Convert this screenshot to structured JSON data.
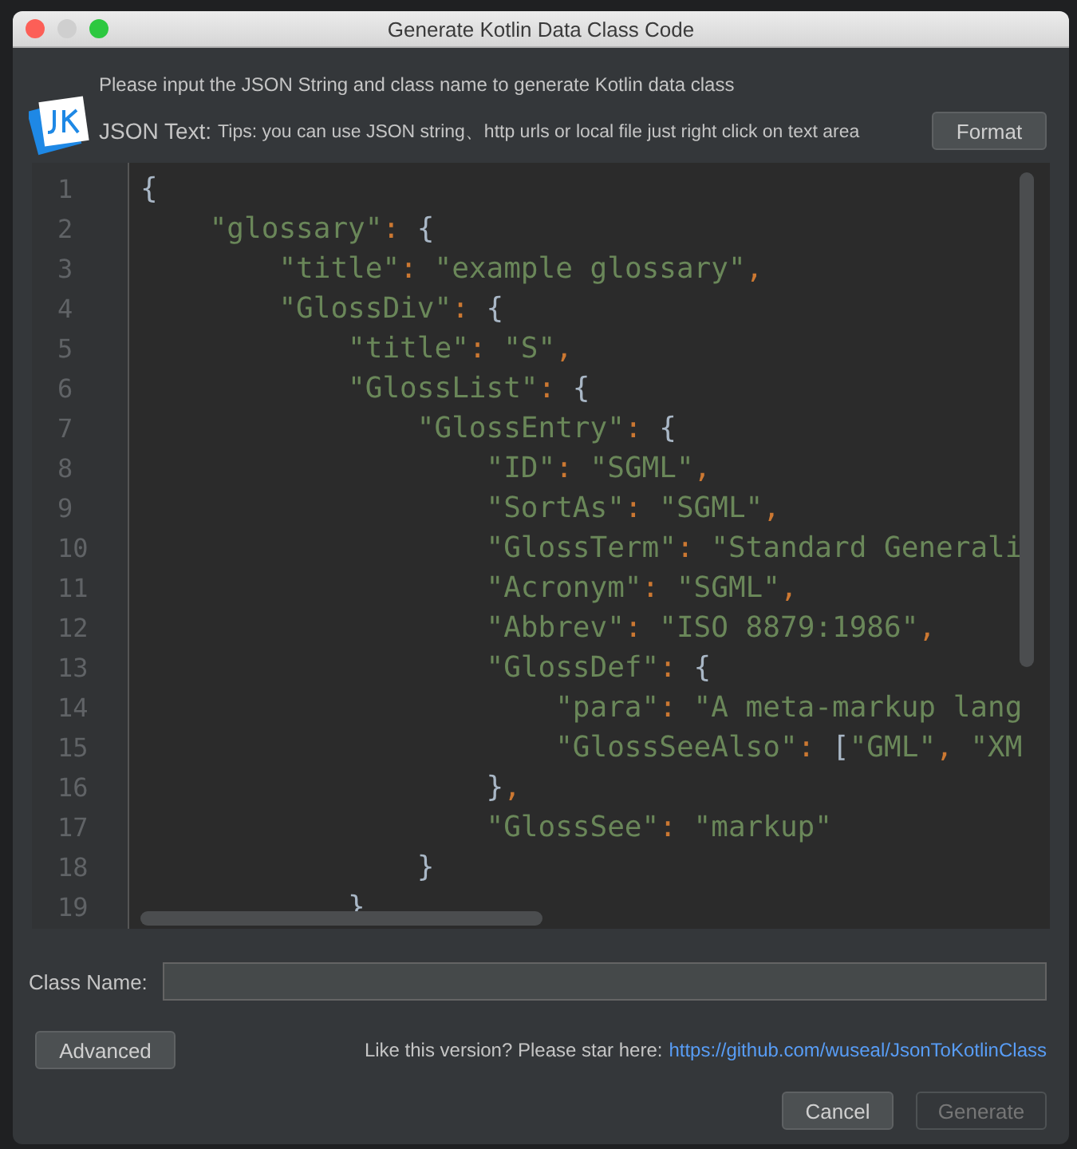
{
  "window": {
    "title": "Generate Kotlin Data Class Code"
  },
  "header": {
    "description": "Please input the JSON String and class name to generate Kotlin data class"
  },
  "json_text": {
    "label": "JSON Text:",
    "tips": "Tips: you can use JSON string、http urls or local file just right click on text area",
    "format_button": "Format"
  },
  "editor": {
    "lines": [
      {
        "number": "1",
        "tokens": [
          {
            "kind": "brace",
            "text": "{"
          }
        ]
      },
      {
        "number": "2",
        "tokens": [
          {
            "kind": "str",
            "text": "    \"glossary\""
          },
          {
            "kind": "punct",
            "text": ":"
          },
          {
            "kind": "brace",
            "text": " {"
          }
        ]
      },
      {
        "number": "3",
        "tokens": [
          {
            "kind": "str",
            "text": "        \"title\""
          },
          {
            "kind": "punct",
            "text": ":"
          },
          {
            "kind": "str",
            "text": " \"example glossary\""
          },
          {
            "kind": "punct",
            "text": ","
          }
        ]
      },
      {
        "number": "4",
        "tokens": [
          {
            "kind": "str",
            "text": "        \"GlossDiv\""
          },
          {
            "kind": "punct",
            "text": ":"
          },
          {
            "kind": "brace",
            "text": " {"
          }
        ]
      },
      {
        "number": "5",
        "tokens": [
          {
            "kind": "str",
            "text": "            \"title\""
          },
          {
            "kind": "punct",
            "text": ":"
          },
          {
            "kind": "str",
            "text": " \"S\""
          },
          {
            "kind": "punct",
            "text": ","
          }
        ]
      },
      {
        "number": "6",
        "tokens": [
          {
            "kind": "str",
            "text": "            \"GlossList\""
          },
          {
            "kind": "punct",
            "text": ":"
          },
          {
            "kind": "brace",
            "text": " {"
          }
        ]
      },
      {
        "number": "7",
        "tokens": [
          {
            "kind": "str",
            "text": "                \"GlossEntry\""
          },
          {
            "kind": "punct",
            "text": ":"
          },
          {
            "kind": "brace",
            "text": " {"
          }
        ]
      },
      {
        "number": "8",
        "tokens": [
          {
            "kind": "str",
            "text": "                    \"ID\""
          },
          {
            "kind": "punct",
            "text": ":"
          },
          {
            "kind": "str",
            "text": " \"SGML\""
          },
          {
            "kind": "punct",
            "text": ","
          }
        ]
      },
      {
        "number": "9",
        "tokens": [
          {
            "kind": "str",
            "text": "                    \"SortAs\""
          },
          {
            "kind": "punct",
            "text": ":"
          },
          {
            "kind": "str",
            "text": " \"SGML\""
          },
          {
            "kind": "punct",
            "text": ","
          }
        ]
      },
      {
        "number": "10",
        "tokens": [
          {
            "kind": "str",
            "text": "                    \"GlossTerm\""
          },
          {
            "kind": "punct",
            "text": ":"
          },
          {
            "kind": "str",
            "text": " \"Standard Generali"
          }
        ]
      },
      {
        "number": "11",
        "tokens": [
          {
            "kind": "str",
            "text": "                    \"Acronym\""
          },
          {
            "kind": "punct",
            "text": ":"
          },
          {
            "kind": "str",
            "text": " \"SGML\""
          },
          {
            "kind": "punct",
            "text": ","
          }
        ]
      },
      {
        "number": "12",
        "tokens": [
          {
            "kind": "str",
            "text": "                    \"Abbrev\""
          },
          {
            "kind": "punct",
            "text": ":"
          },
          {
            "kind": "str",
            "text": " \"ISO 8879:1986\""
          },
          {
            "kind": "punct",
            "text": ","
          }
        ]
      },
      {
        "number": "13",
        "tokens": [
          {
            "kind": "str",
            "text": "                    \"GlossDef\""
          },
          {
            "kind": "punct",
            "text": ":"
          },
          {
            "kind": "brace",
            "text": " {"
          }
        ]
      },
      {
        "number": "14",
        "tokens": [
          {
            "kind": "str",
            "text": "                        \"para\""
          },
          {
            "kind": "punct",
            "text": ":"
          },
          {
            "kind": "str",
            "text": " \"A meta-markup lang"
          }
        ]
      },
      {
        "number": "15",
        "tokens": [
          {
            "kind": "str",
            "text": "                        \"GlossSeeAlso\""
          },
          {
            "kind": "punct",
            "text": ":"
          },
          {
            "kind": "brace",
            "text": " ["
          },
          {
            "kind": "str",
            "text": "\"GML\""
          },
          {
            "kind": "punct",
            "text": ","
          },
          {
            "kind": "str",
            "text": " \"XM"
          }
        ]
      },
      {
        "number": "16",
        "tokens": [
          {
            "kind": "brace",
            "text": "                    }"
          },
          {
            "kind": "punct",
            "text": ","
          }
        ]
      },
      {
        "number": "17",
        "tokens": [
          {
            "kind": "str",
            "text": "                    \"GlossSee\""
          },
          {
            "kind": "punct",
            "text": ":"
          },
          {
            "kind": "str",
            "text": " \"markup\""
          }
        ]
      },
      {
        "number": "18",
        "tokens": [
          {
            "kind": "brace",
            "text": "                }"
          }
        ]
      },
      {
        "number": "19",
        "tokens": [
          {
            "kind": "brace",
            "text": "            }"
          }
        ]
      }
    ]
  },
  "class_name": {
    "label": "Class Name:"
  },
  "advanced_button": "Advanced",
  "promo": {
    "text": "Like this version? Please star here:",
    "link": "https://github.com/wuseal/JsonToKotlinClass"
  },
  "buttons": [
    {
      "label": "Cancel",
      "disabled": false
    },
    {
      "label": "Generate",
      "disabled": true
    }
  ]
}
